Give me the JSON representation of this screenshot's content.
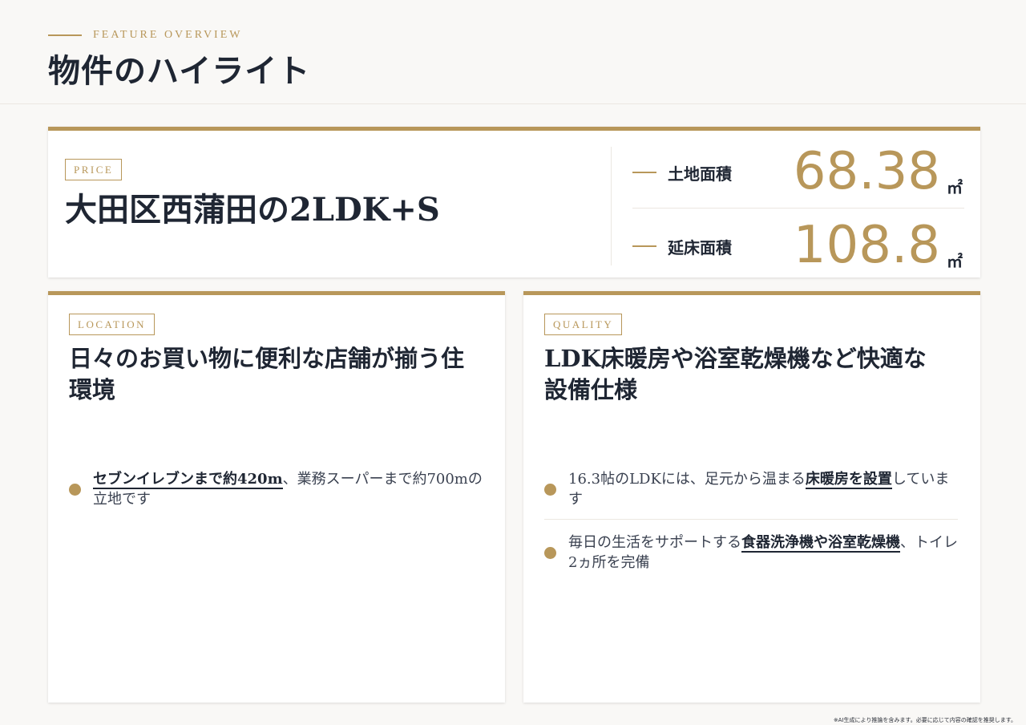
{
  "header": {
    "eyebrow": "FEATURE OVERVIEW",
    "title": "物件のハイライト"
  },
  "price_card": {
    "tag": "PRICE",
    "title": "大田区西蒲田の2LDK+S",
    "stats": [
      {
        "label": "土地面積",
        "value": "68.38",
        "unit": "㎡"
      },
      {
        "label": "延床面積",
        "value": "108.8",
        "unit": "㎡"
      }
    ]
  },
  "location_card": {
    "tag": "LOCATION",
    "title": "日々のお買い物に便利な店舗が揃う住環境",
    "bullets": [
      {
        "highlight": "セブンイレブンまで約420m",
        "rest": "、業務スーパーまで約700mの立地です"
      }
    ]
  },
  "quality_card": {
    "tag": "QUALITY",
    "title": "LDK床暖房や浴室乾燥機など快適な設備仕様",
    "bullets": [
      {
        "before": "16.3帖のLDKには、足元から温まる",
        "highlight": "床暖房を設置",
        "after": "しています"
      },
      {
        "before": "毎日の生活をサポートする",
        "highlight": "食器洗浄機や浴室乾燥機",
        "after": "、トイレ2ヵ所を完備"
      }
    ]
  },
  "footnote": "※AI生成により推論を含みます。必要に応じて内容の確認を推奨します。",
  "colors": {
    "accent": "#b8975a",
    "text": "#1f2633",
    "background": "#f9f8f6"
  }
}
